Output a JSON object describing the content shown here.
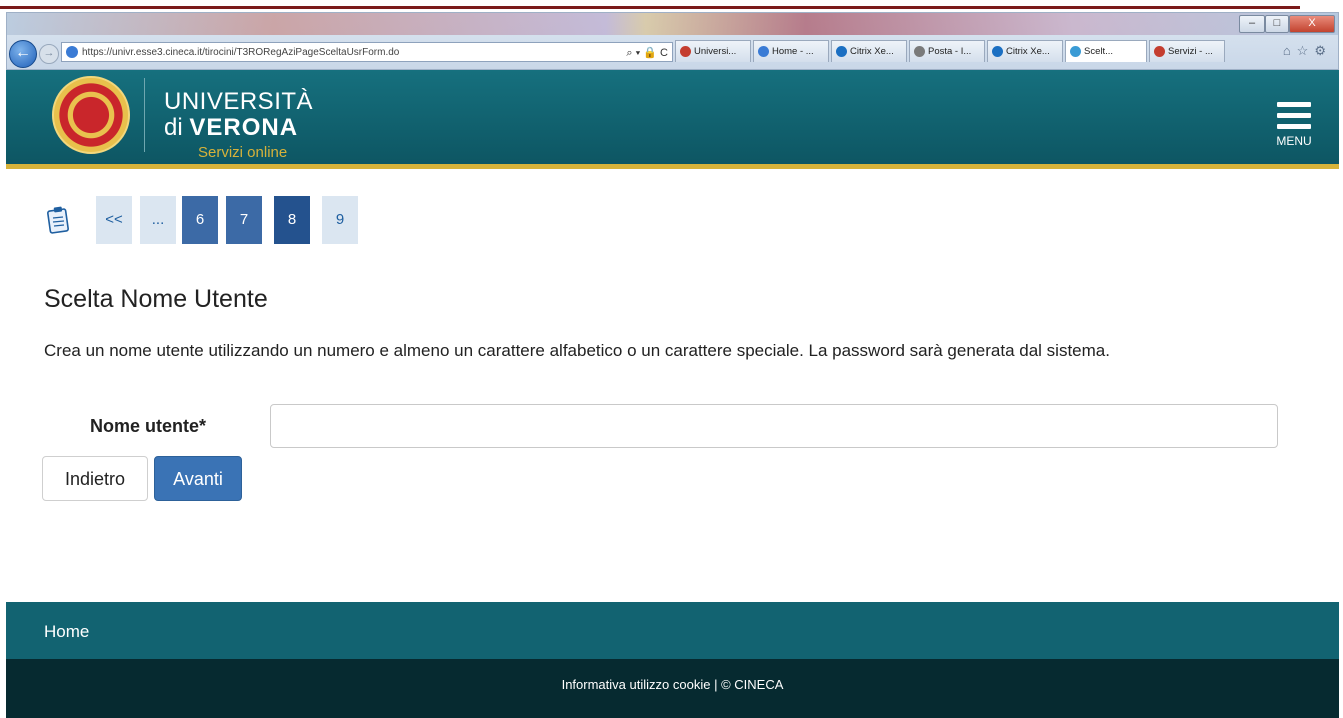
{
  "browser": {
    "address_url": "https://univr.esse3.cineca.it/tirocini/T3RORegAziPageSceltaUsrForm.do",
    "address_tools": "⌕ ▾ 🔒 C",
    "tabs": [
      {
        "label": "Universi...",
        "color": "#c43d2f",
        "active": false
      },
      {
        "label": "Home - ...",
        "color": "#3a7bd5",
        "active": false
      },
      {
        "label": "Citrix Xe...",
        "color": "#1b6fc2",
        "active": false
      },
      {
        "label": "Posta - I...",
        "color": "#7a7a7a",
        "active": false
      },
      {
        "label": "Citrix Xe...",
        "color": "#1b6fc2",
        "active": false
      },
      {
        "label": "Scelt...",
        "color": "#3a9bd5",
        "active": true
      },
      {
        "label": "Servizi - ...",
        "color": "#c43d2f",
        "active": false
      }
    ],
    "window_controls": {
      "minimize": "–",
      "maximize": "□",
      "close": "X"
    },
    "right_icons": "⌂☆⚙"
  },
  "header": {
    "line1": "UNIVERSITÀ",
    "line2_prefix": "di",
    "line2_bold": "VERONA",
    "line3": "Servizi online",
    "menu_label": "MENU"
  },
  "pager": {
    "items": [
      {
        "label": "<<",
        "style": "light"
      },
      {
        "label": "...",
        "style": "light"
      },
      {
        "label": "6",
        "style": "dark"
      },
      {
        "label": "7",
        "style": "dark"
      },
      {
        "label": "8",
        "style": "active"
      },
      {
        "label": "9",
        "style": "light"
      }
    ]
  },
  "form": {
    "title": "Scelta Nome Utente",
    "intro": "Crea un nome utente utilizzando un numero e almeno un carattere alfabetico o un carattere speciale. La password sarà generata dal sistema.",
    "username_label": "Nome utente*",
    "username_value": "",
    "back_label": "Indietro",
    "next_label": "Avanti"
  },
  "footer": {
    "home_link": "Home",
    "cookie_link": "Informativa utilizzo cookie",
    "separator": "|",
    "copyright": "© CINECA"
  },
  "colors": {
    "header_teal": "#0f6572",
    "accent_yellow": "#d6b23a",
    "button_blue": "#3a73b5",
    "footer_dark": "#062a30"
  }
}
